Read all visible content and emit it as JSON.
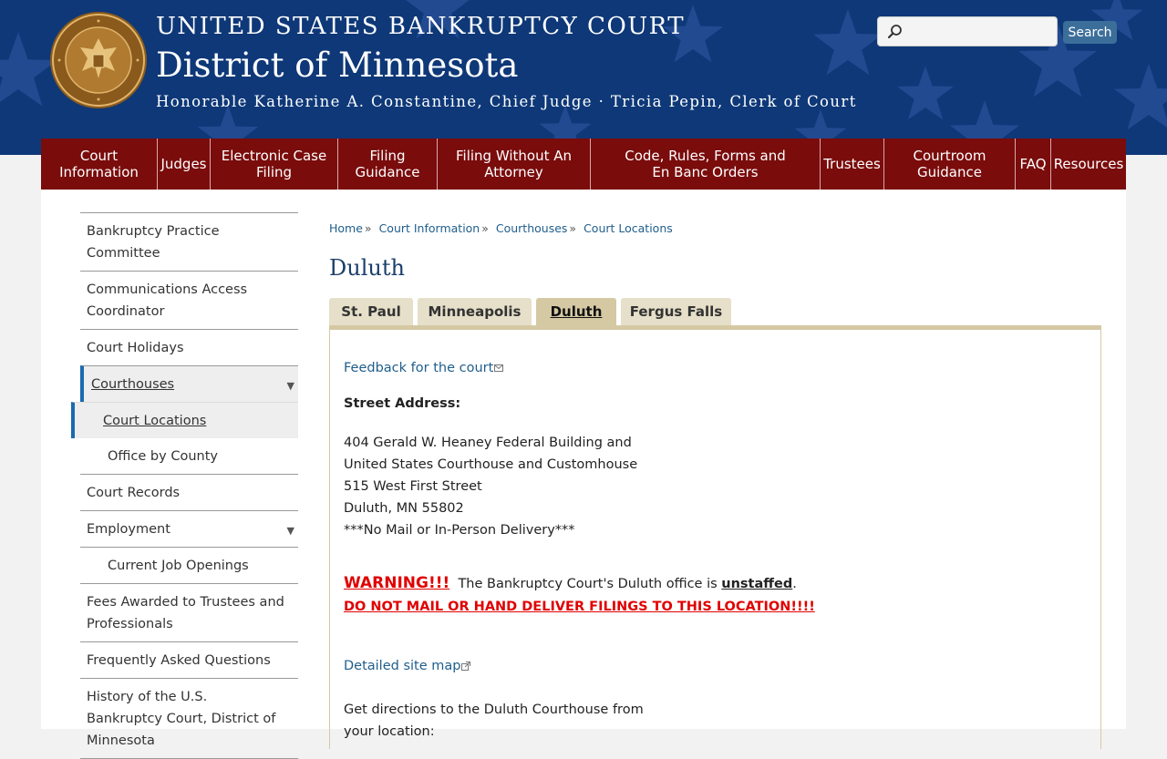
{
  "header": {
    "court_name": "UNITED STATES BANKRUPTCY COURT",
    "district_name": "District of Minnesota",
    "judges_line": "Honorable Katherine A. Constantine, Chief Judge · Tricia Pepin, Clerk of Court",
    "search": {
      "placeholder": "",
      "button_label": "Search"
    },
    "colors": {
      "banner": "#0e3878",
      "nav": "#7a0c0c"
    }
  },
  "nav": {
    "items": [
      {
        "label": "Court\nInformation",
        "width": 128
      },
      {
        "label": "Judges",
        "width": 58
      },
      {
        "label": "Electronic Case\nFiling",
        "width": 140
      },
      {
        "label": "Filing\nGuidance",
        "width": 109
      },
      {
        "label": "Filing Without An\nAttorney",
        "width": 168
      },
      {
        "label": "Code, Rules, Forms and\nEn Banc Orders",
        "width": 252
      },
      {
        "label": "Trustees",
        "width": 70
      },
      {
        "label": "Courtroom\nGuidance",
        "width": 144
      },
      {
        "label": "FAQ",
        "width": 39
      },
      {
        "label": "Resources",
        "width": 82
      }
    ]
  },
  "sidebar": {
    "items": [
      {
        "label": "Bankruptcy Practice Committee"
      },
      {
        "label": "Communications Access Coordinator"
      },
      {
        "label": "Court Holidays"
      },
      {
        "label": "Courthouses"
      },
      {
        "label": "Court Locations"
      },
      {
        "label": "Office by County"
      },
      {
        "label": "Court Records"
      },
      {
        "label": "Employment"
      },
      {
        "label": "Current Job Openings"
      },
      {
        "label": "Fees Awarded to Trustees and Professionals"
      },
      {
        "label": "Frequently Asked Questions"
      },
      {
        "label": "History of the U.S. Bankruptcy Court, District of Minnesota"
      }
    ]
  },
  "breadcrumb": {
    "items": [
      "Home",
      "Court Information",
      "Courthouses",
      "Court Locations"
    ],
    "separator": "»"
  },
  "page": {
    "title": "Duluth",
    "tabs": [
      "St. Paul",
      "Minneapolis",
      "Duluth",
      "Fergus Falls"
    ],
    "feedback_link": "Feedback for the court",
    "street_address_label": "Street Address:",
    "address_lines": [
      "404 Gerald W. Heaney Federal Building and",
      "United States Courthouse and Customhouse",
      "515 West First Street",
      "Duluth, MN 55802",
      "***No Mail or In-Person Delivery***"
    ],
    "warning_label": "WARNING!!!",
    "warning_text_pre": "The Bankruptcy Court's Duluth office is",
    "warning_strong": "unstaffed",
    "warning_text_post": ".",
    "warning_notice": "DO NOT MAIL OR HAND DELIVER FILINGS TO THIS LOCATION!!!!",
    "site_map_link": "Detailed site map",
    "directions_line1": "Get directions to the Duluth Courthouse from",
    "directions_line2": "your location:"
  }
}
